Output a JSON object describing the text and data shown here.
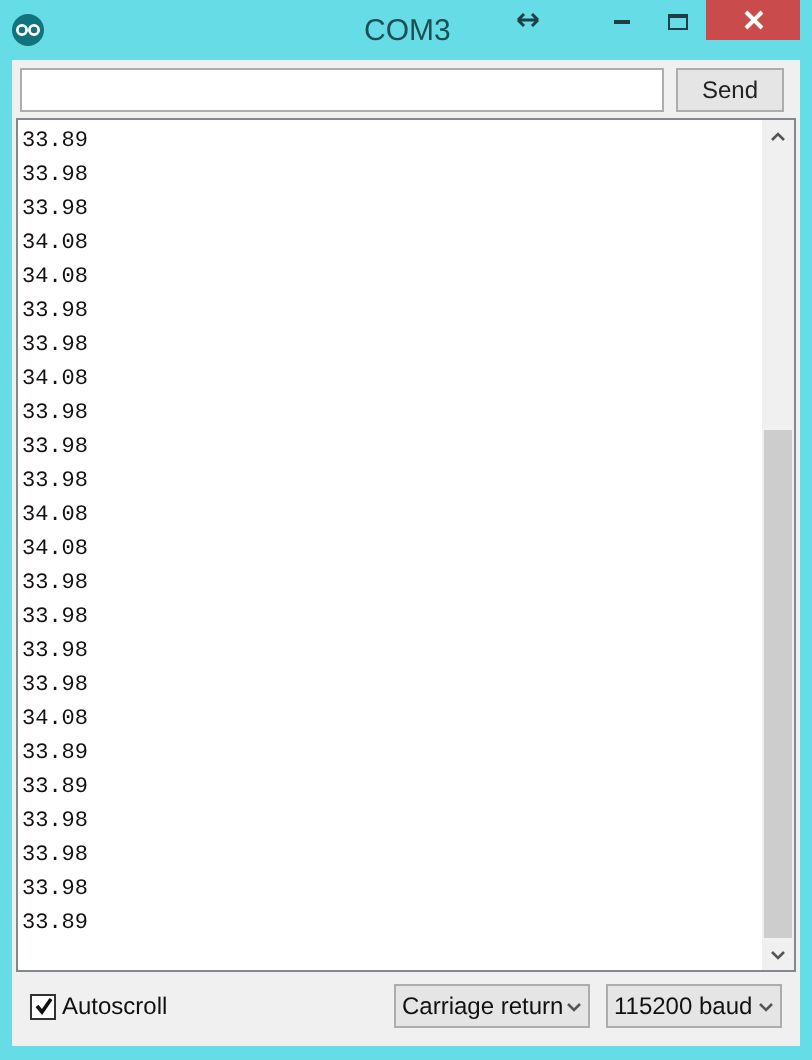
{
  "window": {
    "title": "COM3"
  },
  "send_button": "Send",
  "output_lines": [
    "33.89",
    "33.98",
    "33.98",
    "34.08",
    "34.08",
    "33.98",
    "33.98",
    "34.08",
    "33.98",
    "33.98",
    "33.98",
    "34.08",
    "34.08",
    "33.98",
    "33.98",
    "33.98",
    "33.98",
    "34.08",
    "33.89",
    "33.89",
    "33.98",
    "33.98",
    "33.98",
    "33.89"
  ],
  "autoscroll": {
    "label": "Autoscroll",
    "checked": true
  },
  "line_ending": {
    "value": "Carriage return"
  },
  "baud_rate": {
    "value": "115200 baud"
  }
}
